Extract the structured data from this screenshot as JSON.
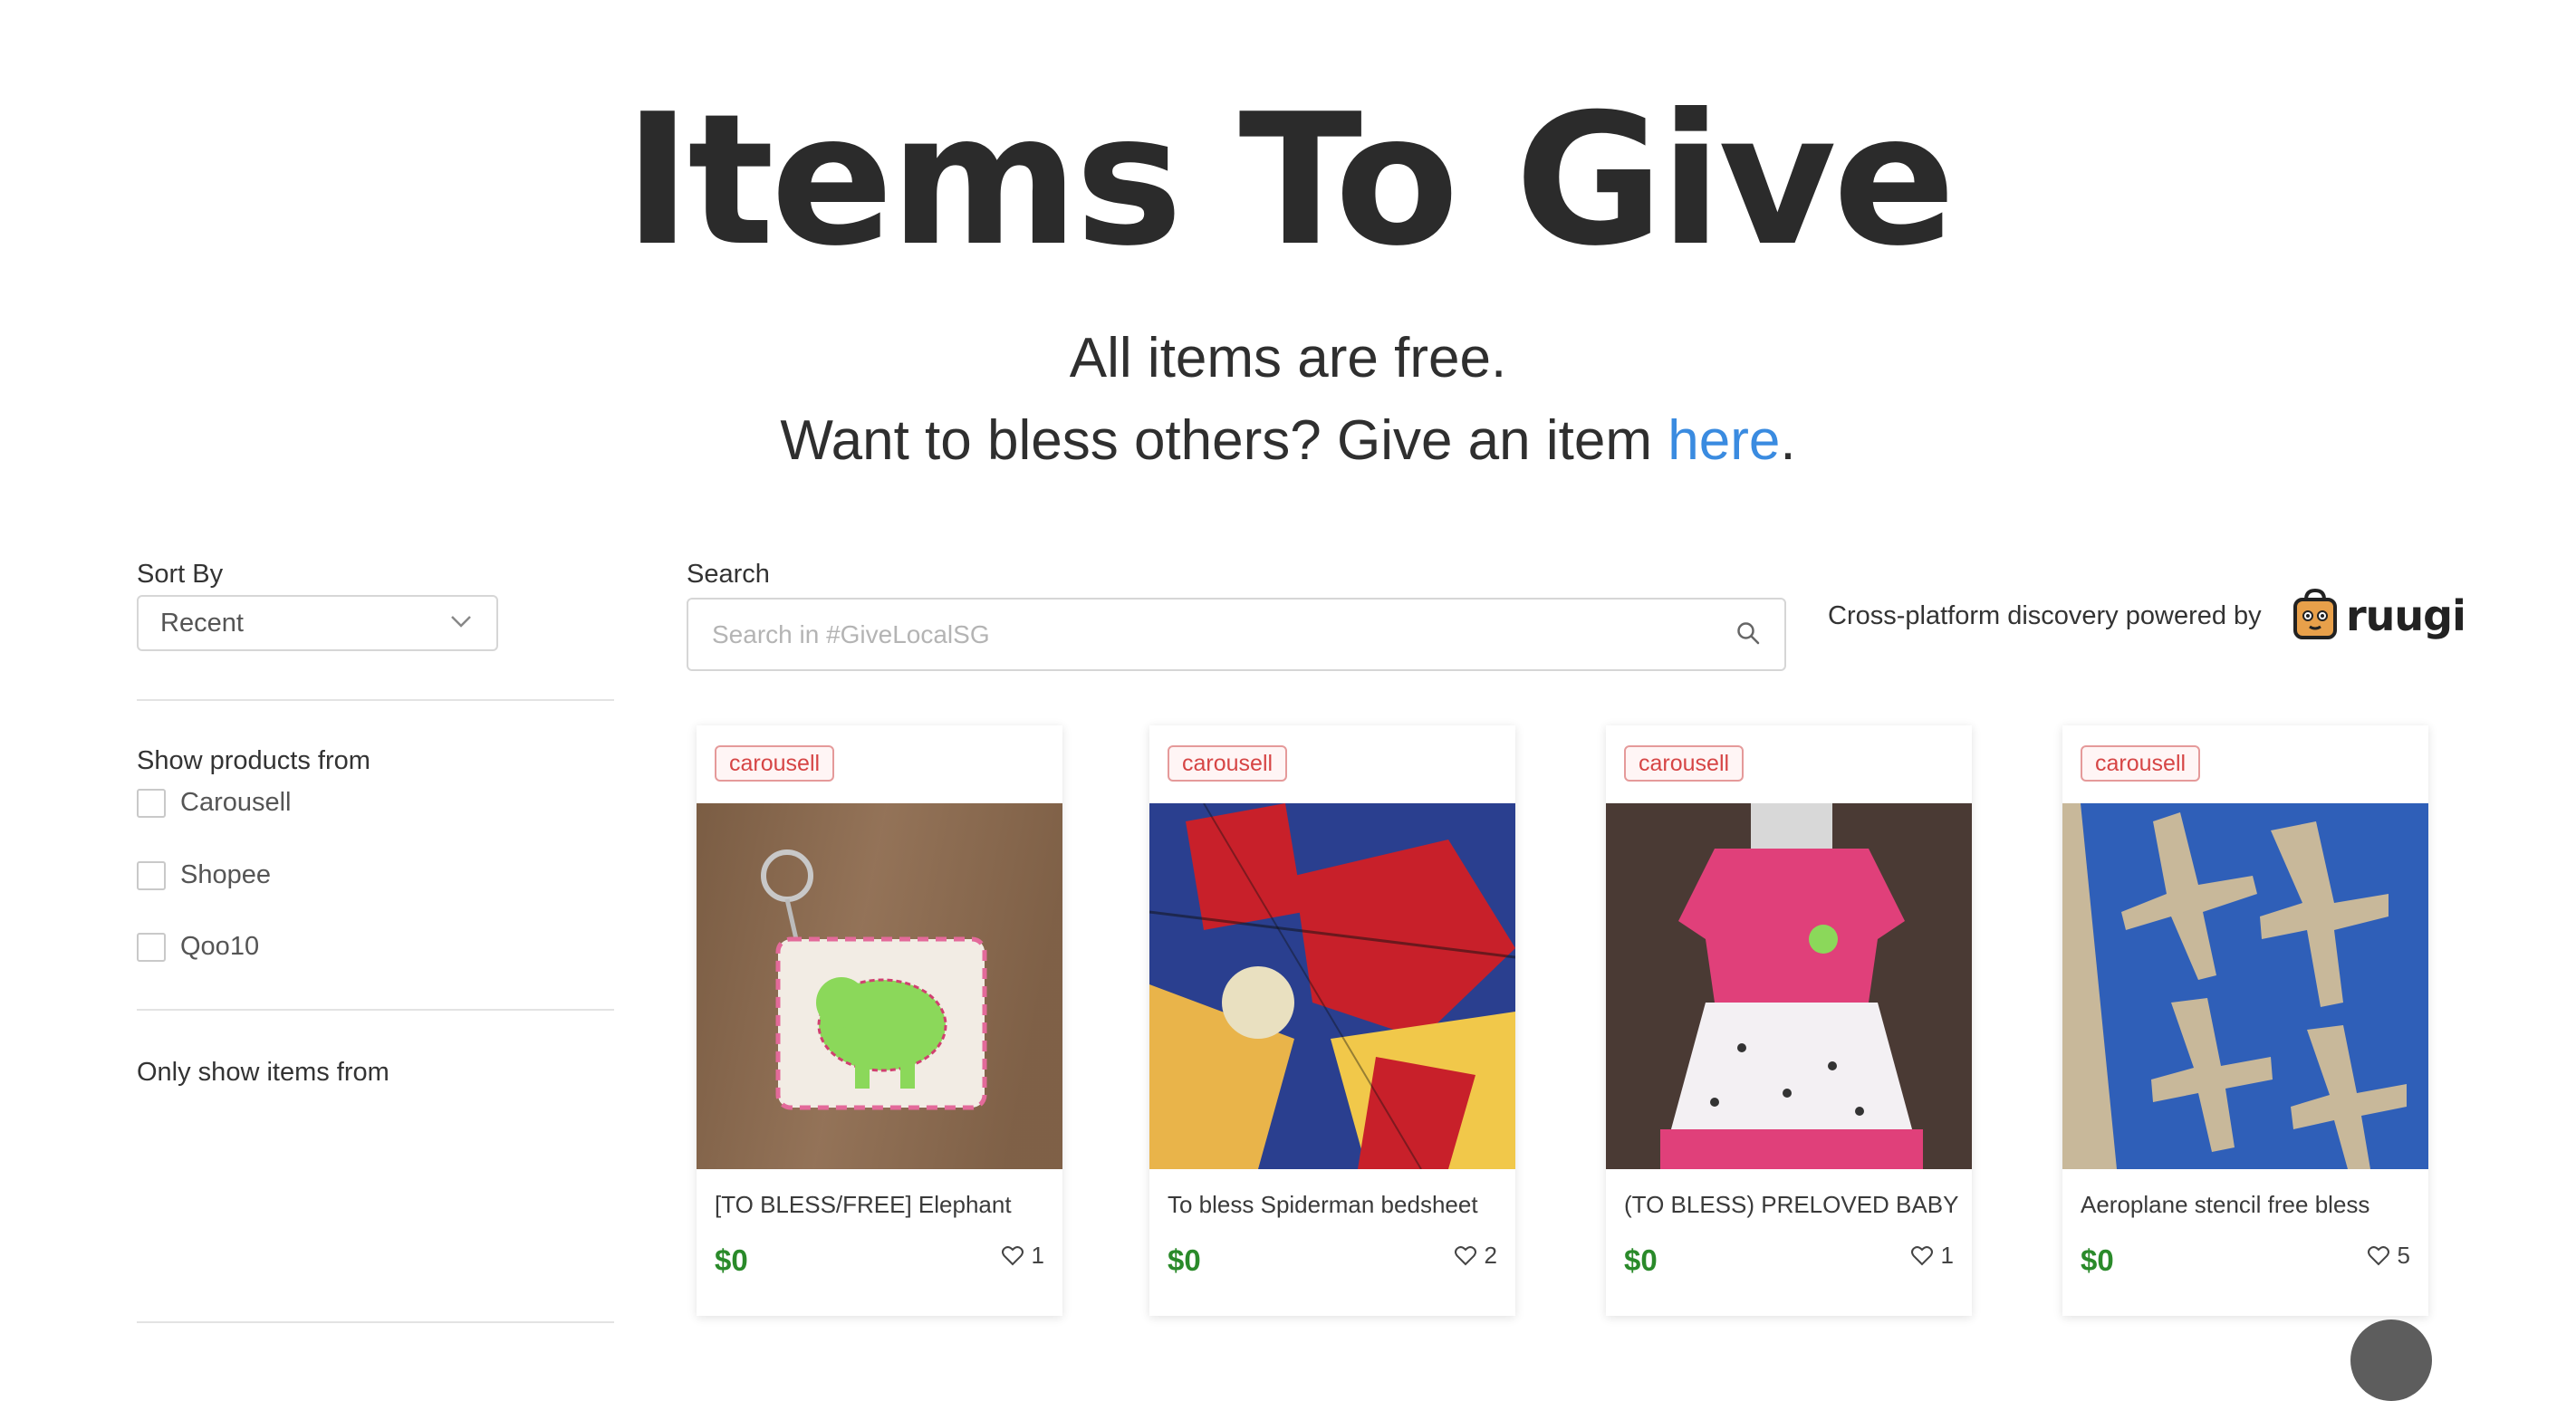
{
  "header": {
    "title": "Items To Give",
    "subtitle_line1": "All items are free.",
    "subtitle_line2_prefix": "Want to bless others? Give an item ",
    "subtitle_link": "here",
    "subtitle_line2_suffix": "."
  },
  "sort": {
    "label": "Sort By",
    "selected": "Recent"
  },
  "filters": {
    "show_from_label": "Show products from",
    "platforms": [
      "Carousell",
      "Shopee",
      "Qoo10"
    ],
    "only_from_label": "Only show items from"
  },
  "search": {
    "label": "Search",
    "placeholder": "Search in #GiveLocalSG"
  },
  "powered_by": {
    "text": "Cross-platform discovery powered by",
    "brand": "ruugi"
  },
  "colors": {
    "accent_link": "#3a8be0",
    "price_green": "#2a8a2a",
    "badge_red": "#d64545"
  },
  "cards": [
    {
      "source": "carousell",
      "title": "[TO BLESS/FREE] Elephant",
      "price": "$0",
      "likes": "1",
      "image": "elephant-coin-pouch"
    },
    {
      "source": "carousell",
      "title": "To bless Spiderman bedsheet",
      "price": "$0",
      "likes": "2",
      "image": "spiderman-bedsheet"
    },
    {
      "source": "carousell",
      "title": "(TO BLESS) PRELOVED BABY",
      "price": "$0",
      "likes": "1",
      "image": "pink-baby-dress"
    },
    {
      "source": "carousell",
      "title": "Aeroplane stencil free bless",
      "price": "$0",
      "likes": "5",
      "image": "blue-aeroplane-stencil"
    }
  ]
}
